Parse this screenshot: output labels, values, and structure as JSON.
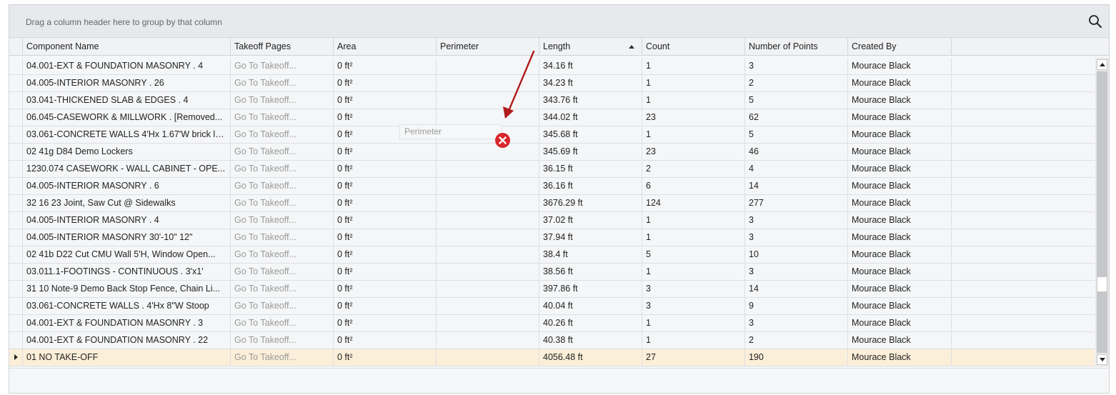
{
  "group_panel": {
    "hint": "Drag a column header here to group by that column"
  },
  "columns": [
    {
      "label": "Component Name"
    },
    {
      "label": "Takeoff Pages"
    },
    {
      "label": "Area"
    },
    {
      "label": "Perimeter"
    },
    {
      "label": "Length"
    },
    {
      "label": "Count"
    },
    {
      "label": "Number of Points"
    },
    {
      "label": "Created By"
    }
  ],
  "sort": {
    "column": "Length",
    "direction": "ascending"
  },
  "rows": [
    [
      "04.001-EXT & FOUNDATION MASONRY . 4",
      "Go To Takeoff...",
      "0 ft²",
      "",
      "34.16 ft",
      "1",
      "3",
      "Mourace Black"
    ],
    [
      "04.005-INTERIOR MASONRY . 26",
      "Go To Takeoff...",
      "0 ft²",
      "",
      "34.23 ft",
      "1",
      "2",
      "Mourace Black"
    ],
    [
      "03.041-THICKENED SLAB & EDGES . 4",
      "Go To Takeoff...",
      "0 ft²",
      "",
      "343.76 ft",
      "1",
      "5",
      "Mourace Black"
    ],
    [
      "06.045-CASEWORK & MILLWORK . [Removed...",
      "Go To Takeoff...",
      "0 ft²",
      "",
      "344.02 ft",
      "23",
      "62",
      "Mourace Black"
    ],
    [
      "03.061-CONCRETE WALLS 4'Hx 1.67'W brick le...",
      "Go To Takeoff...",
      "0 ft²",
      "",
      "345.68 ft",
      "1",
      "5",
      "Mourace Black"
    ],
    [
      "02 41g  D84 Demo Lockers",
      "Go To Takeoff...",
      "0 ft²",
      "",
      "345.69 ft",
      "23",
      "46",
      "Mourace Black"
    ],
    [
      "1230.074 CASEWORK - WALL CABINET - OPE...",
      "Go To Takeoff...",
      "0 ft²",
      "",
      "36.15 ft",
      "2",
      "4",
      "Mourace Black"
    ],
    [
      "04.005-INTERIOR MASONRY . 6",
      "Go To Takeoff...",
      "0 ft²",
      "",
      "36.16 ft",
      "6",
      "14",
      "Mourace Black"
    ],
    [
      "32 16 23  Joint, Saw Cut @ Sidewalks",
      "Go To Takeoff...",
      "0 ft²",
      "",
      "3676.29 ft",
      "124",
      "277",
      "Mourace Black"
    ],
    [
      "04.005-INTERIOR MASONRY . 4",
      "Go To Takeoff...",
      "0 ft²",
      "",
      "37.02 ft",
      "1",
      "3",
      "Mourace Black"
    ],
    [
      "04.005-INTERIOR MASONRY 30'-10\" 12\"",
      "Go To Takeoff...",
      "0 ft²",
      "",
      "37.94 ft",
      "1",
      "3",
      "Mourace Black"
    ],
    [
      "02 41b  D22 Cut CMU Wall 5'H, Window Open...",
      "Go To Takeoff...",
      "0 ft²",
      "",
      "38.4 ft",
      "5",
      "10",
      "Mourace Black"
    ],
    [
      "03.011.1-FOOTINGS - CONTINUOUS . 3'x1'",
      "Go To Takeoff...",
      "0 ft²",
      "",
      "38.56 ft",
      "1",
      "3",
      "Mourace Black"
    ],
    [
      "31 10 Note-9 Demo Back Stop Fence, Chain Li...",
      "Go To Takeoff...",
      "0 ft²",
      "",
      "397.86 ft",
      "3",
      "14",
      "Mourace Black"
    ],
    [
      "03.061-CONCRETE WALLS . 4'Hx 8\"W Stoop",
      "Go To Takeoff...",
      "0 ft²",
      "",
      "40.04 ft",
      "3",
      "9",
      "Mourace Black"
    ],
    [
      "04.001-EXT & FOUNDATION MASONRY . 3",
      "Go To Takeoff...",
      "0 ft²",
      "",
      "40.26 ft",
      "1",
      "3",
      "Mourace Black"
    ],
    [
      "04.001-EXT & FOUNDATION MASONRY . 22",
      "Go To Takeoff...",
      "0 ft²",
      "",
      "40.38 ft",
      "1",
      "2",
      "Mourace Black"
    ],
    [
      "01 NO TAKE-OFF",
      "Go To Takeoff...",
      "0 ft²",
      "",
      "4056.48 ft",
      "27",
      "190",
      "Mourace Black"
    ]
  ],
  "selected_row": 17,
  "drag": {
    "label": "Perimeter"
  },
  "colors": {
    "selected_row": "#fcefd9",
    "no_drop": "#d9262c",
    "annotation_arrow": "#b01c1c"
  }
}
